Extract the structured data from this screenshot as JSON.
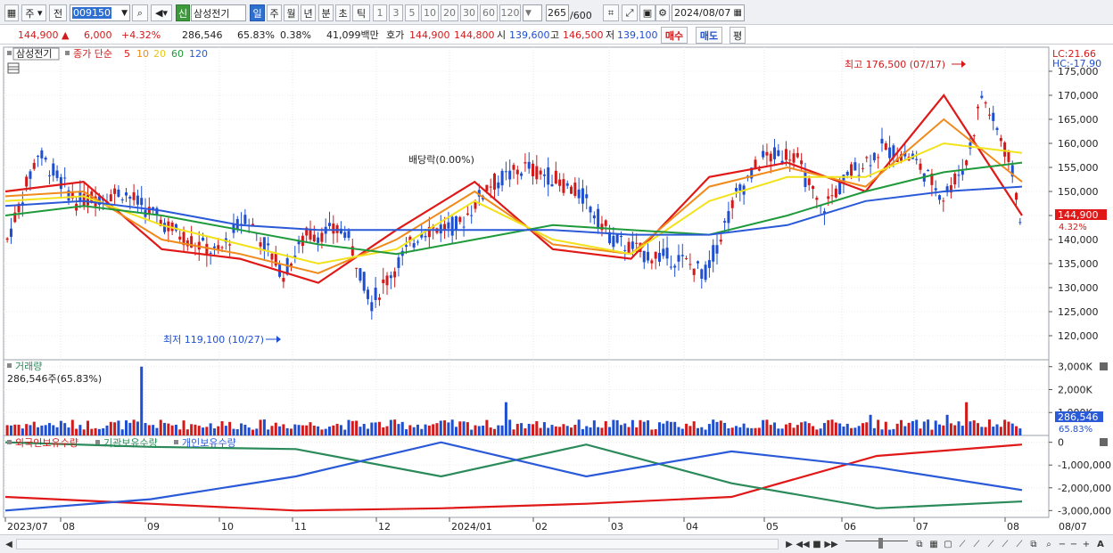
{
  "toolbar": {
    "market": "주",
    "prev_label": "전",
    "code": "009150",
    "market_badge": "신",
    "stock_name": "삼성전기",
    "periods": [
      "일",
      "주",
      "월",
      "년",
      "분",
      "초",
      "틱"
    ],
    "active_period": "일",
    "intervals": [
      "1",
      "3",
      "5",
      "10",
      "20",
      "30",
      "60",
      "120"
    ],
    "count": "265",
    "count_max": "/600",
    "date": "2024/08/07"
  },
  "info": {
    "price": "144,900",
    "change": "6,000",
    "change_pct": "+4.32%",
    "volume": "286,546",
    "volume_ratio": "65.83%",
    "turnover": "0.38%",
    "amount": "41,099백만",
    "quote_label": "호가",
    "ask": "144,900",
    "bid": "144,800",
    "open_label": "시",
    "open": "139,600",
    "high_label": "고",
    "high": "146,500",
    "low_label": "저",
    "low": "139,100",
    "buy_btn": "매수",
    "sell_btn": "매도",
    "eval_btn": "평"
  },
  "price_panel": {
    "name_tag": "삼성전기",
    "legend_prefix": "종가 단순",
    "ma_labels": [
      "5",
      "10",
      "20",
      "60",
      "120"
    ],
    "lc_label": "LC:21.66",
    "hc_label": "HC:-17.90",
    "high_annotation": "최고 176,500 (07/17)",
    "low_annotation": "최저 119,100 (10/27)",
    "dividend_annotation": "배당락(0.00%)",
    "current_price_tag": "144,900",
    "current_pct_tag": "4.32%",
    "y_ticks": [
      "175,000",
      "170,000",
      "165,000",
      "160,000",
      "155,000",
      "150,000",
      "145,000",
      "140,000",
      "135,000",
      "130,000",
      "125,000",
      "120,000"
    ]
  },
  "volume_panel": {
    "title": "거래량",
    "value_label": "286,546주(65.83%)",
    "y_ticks": [
      "3,000K",
      "2,000K",
      "1,000K"
    ],
    "current_tag": "286,546",
    "current_pct": "65.83%"
  },
  "holdings_panel": {
    "legend": [
      "외국인보유수량",
      "기관보유수량",
      "개인보유수량"
    ],
    "y_ticks": [
      "0",
      "-1,000,000",
      "-2,000,000",
      "-3,000,000"
    ]
  },
  "x_axis": {
    "labels": [
      "2023/07",
      "08",
      "09",
      "10",
      "11",
      "12",
      "2024/01",
      "02",
      "03",
      "04",
      "05",
      "06",
      "07",
      "08",
      "08/07"
    ]
  },
  "colors": {
    "up": "#d21a1a",
    "down": "#1e4fd0",
    "ma5": "#e01818",
    "ma10": "#f08a1a",
    "ma20": "#f2e21a",
    "ma60": "#1f9a3a",
    "ma120": "#2a5ad8",
    "foreign": "#e01818",
    "institution": "#2a8a5a",
    "individual": "#2a5ad8"
  },
  "chart_data": [
    {
      "type": "line",
      "title": "",
      "note": "daily price with moving averages (approximate shape)",
      "x": [
        "2023/07",
        "2023/08",
        "2023/09",
        "2023/10",
        "2023/11",
        "2023/12",
        "2024/01",
        "2024/02",
        "2024/03",
        "2024/04",
        "2024/05",
        "2024/06",
        "2024/07",
        "2024/08"
      ],
      "series": [
        {
          "name": "5",
          "values": [
            150000,
            152000,
            138000,
            136000,
            131000,
            142000,
            152000,
            138000,
            136000,
            153000,
            156000,
            150000,
            170000,
            145000
          ]
        },
        {
          "name": "10",
          "values": [
            149000,
            150000,
            140000,
            137000,
            133000,
            140000,
            150000,
            139000,
            137000,
            151000,
            155000,
            151000,
            165000,
            152000
          ]
        },
        {
          "name": "20",
          "values": [
            148000,
            149000,
            143000,
            139000,
            135000,
            138000,
            148000,
            140000,
            137000,
            148000,
            153000,
            153000,
            160000,
            158000
          ]
        },
        {
          "name": "60",
          "values": [
            145000,
            147000,
            145000,
            142000,
            139000,
            137000,
            140000,
            143000,
            142000,
            141000,
            145000,
            150000,
            154000,
            156000
          ]
        },
        {
          "name": "120",
          "values": [
            147000,
            148000,
            146000,
            143000,
            142000,
            142000,
            142000,
            142000,
            141000,
            141000,
            143000,
            148000,
            150000,
            151000
          ]
        }
      ],
      "ylim": [
        115000,
        180000
      ]
    },
    {
      "type": "bar",
      "title": "거래량",
      "note": "daily volume (approximate)",
      "ylim": [
        0,
        3300000
      ]
    },
    {
      "type": "line",
      "title": "",
      "x": [
        "2023/07",
        "2023/09",
        "2023/11",
        "2024/01",
        "2024/03",
        "2024/05",
        "2024/07",
        "2024/08"
      ],
      "series": [
        {
          "name": "외국인보유수량",
          "values": [
            -2400000,
            -2700000,
            -3000000,
            -2900000,
            -2700000,
            -2400000,
            -600000,
            -100000
          ]
        },
        {
          "name": "기관보유수량",
          "values": [
            0,
            -200000,
            -300000,
            -1500000,
            -100000,
            -1800000,
            -2900000,
            -2600000
          ]
        },
        {
          "name": "개인보유수량",
          "values": [
            -3000000,
            -2500000,
            -1500000,
            0,
            -1500000,
            -400000,
            -1100000,
            -2100000
          ]
        }
      ],
      "ylim": [
        -3300000,
        300000
      ]
    }
  ]
}
